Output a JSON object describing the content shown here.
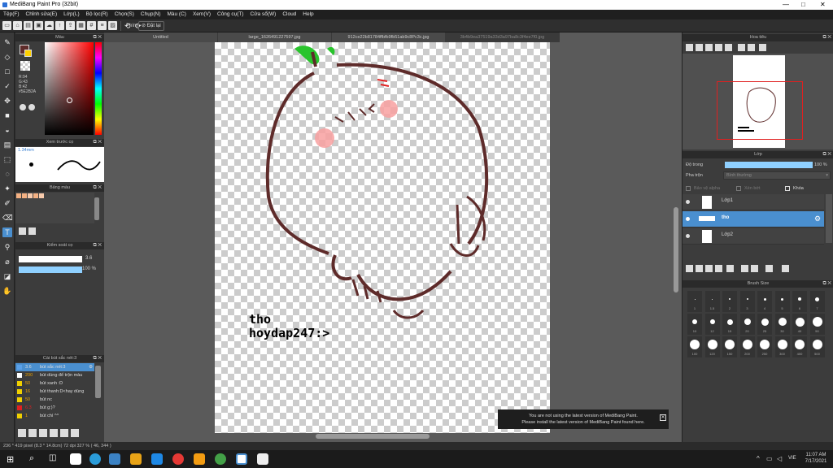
{
  "window": {
    "title": "MediBang Paint Pro (32bit)"
  },
  "menu": [
    "Tệp(F)",
    "Chỉnh sửa(E)",
    "Lớp(L)",
    "Bộ lọc(R)",
    "Chọn(S)",
    "Chụp(N)",
    "Màu (C)",
    "Xem(V)",
    "Công cụ(T)",
    "Cửa sổ(W)",
    "Cloud",
    "Help"
  ],
  "toolbar": {
    "label_phim": "Phím",
    "label_dat_lai": "Đặt lại"
  },
  "tabs": [
    "Untitled",
    "large_1626491227597.jpg",
    "912ce22b81784ffbfb9fb51ab9c8Pc3c.jpg",
    "3b4b9ea37519a33d3a97ba8c3f4ee7f0.jpg"
  ],
  "color_panel": {
    "title": "Màu",
    "r": "R:94",
    "g": "G:43",
    "b": "B:42",
    "hex": "#5E2B2A"
  },
  "brush_preview": {
    "title": "Xem trước cọ",
    "size": "1.34mm"
  },
  "palette": {
    "title": "Bảng màu",
    "swatches": [
      "#f4b183",
      "#f4b183",
      "#f8cbad",
      "#f4b183",
      "#f8cbad"
    ]
  },
  "brush_control": {
    "title": "Kiểm soát cọ",
    "size": "3.6",
    "opacity": "100 %",
    "size_fraction": 0.95,
    "opacity_fraction": 1.0
  },
  "brush_list": {
    "title": "Cài bút sắc nét:3",
    "items": [
      {
        "color": "#5aa0e8",
        "size": "3.6",
        "name": "bút sắc nét:3",
        "selected": true
      },
      {
        "color": "#ffffff",
        "size": "200",
        "name": "bút dùng để trộn màu",
        "selected": false
      },
      {
        "color": "#f0d000",
        "size": "50",
        "name": "bút xanh :D",
        "selected": false
      },
      {
        "color": "#f0d000",
        "size": "16",
        "name": "bút thanh:D<hay dùng",
        "selected": false
      },
      {
        "color": "#f0d000",
        "size": "50",
        "name": "bút nc",
        "selected": false
      },
      {
        "color": "#e02020",
        "size": "6.3",
        "name": "bút g:)?",
        "selected": false
      },
      {
        "color": "#f0d000",
        "size": "1",
        "name": "bút chì ^^",
        "selected": false
      }
    ]
  },
  "navigator": {
    "title": "Hoa tiêu"
  },
  "layers": {
    "title": "Lớp",
    "opacity_label": "Độ trong",
    "opacity_value": "100 %",
    "opacity_fraction": 1.0,
    "blend_label": "Pha trộn",
    "blend_value": "Bình thường",
    "protect_alpha": "Bảo vệ alpha",
    "clipping": "Xén bớt",
    "lock": "Khóa",
    "items": [
      {
        "name": "Lớp1",
        "selected": false
      },
      {
        "name": "tho",
        "selected": true
      },
      {
        "name": "Lớp2",
        "selected": false
      }
    ]
  },
  "brush_size_panel": {
    "title": "Brush Size",
    "rows": [
      [
        "1",
        "1.5",
        "2",
        "3",
        "4",
        "5",
        "6",
        "7"
      ],
      [
        "10",
        "12",
        "15",
        "20",
        "25",
        "30",
        "40",
        "50"
      ],
      [
        "100",
        "120",
        "150",
        "200",
        "250",
        "300",
        "400",
        "500"
      ]
    ]
  },
  "canvas_text": {
    "line1": "tho",
    "line2": "hoydap247:>"
  },
  "notice": {
    "line1": "You are not using the latest version of MediBang Paint.",
    "line2": "Please install the latest version of MediBang Paint found here."
  },
  "status": {
    "text": "236 * 419 pixel   (8.3 * 14.8cm)   72 dpi   327 %   ( 46, 344 )"
  },
  "taskbar": {
    "time": "11:07 AM",
    "date": "7/17/2021",
    "lang": "VIE"
  },
  "colors": {
    "accent": "#4a8fcf",
    "brown": "#5E2B2A"
  }
}
